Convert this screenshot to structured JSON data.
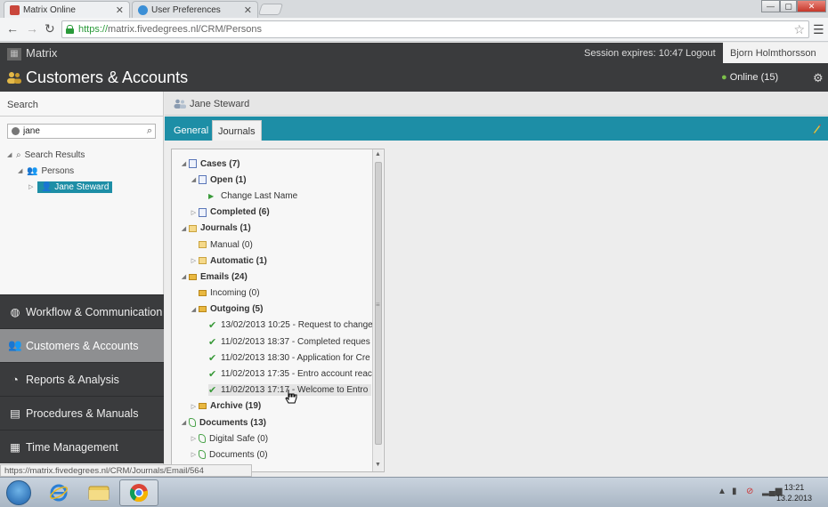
{
  "browser": {
    "tabs": [
      {
        "label": "Matrix Online",
        "active": true
      },
      {
        "label": "User Preferences",
        "active": false
      }
    ],
    "url_scheme": "https://",
    "url_rest": "matrix.fivedegrees.nl/CRM/Persons",
    "status_url": "https://matrix.fivedegrees.nl/CRM/Journals/Email/564"
  },
  "app": {
    "logo": "Matrix",
    "session": "Session expires: 10:47",
    "logout": "Logout",
    "user": "Bjorn Holmthorsson",
    "title": "Customers & Accounts",
    "online": "Online (15)"
  },
  "left": {
    "search_label": "Search",
    "search_value": "jane",
    "tree": {
      "root": "Search Results",
      "group": "Persons",
      "person": "Jane Steward"
    },
    "nav": [
      {
        "label": "Workflow & Communication",
        "active": false
      },
      {
        "label": "Customers & Accounts",
        "active": true
      },
      {
        "label": "Reports & Analysis",
        "active": false
      },
      {
        "label": "Procedures & Manuals",
        "active": false
      },
      {
        "label": "Time Management",
        "active": false
      }
    ]
  },
  "main": {
    "person": "Jane Steward",
    "tabs": [
      {
        "label": "General",
        "active": false
      },
      {
        "label": "Journals",
        "active": true
      }
    ],
    "tree": {
      "cases": "Cases (7)",
      "open": "Open (1)",
      "change_last_name": "Change Last Name",
      "completed": "Completed (6)",
      "journals": "Journals (1)",
      "manual": "Manual (0)",
      "automatic": "Automatic (1)",
      "emails": "Emails (24)",
      "incoming": "Incoming (0)",
      "outgoing": "Outgoing (5)",
      "mails": [
        "13/02/2013 10:25 - Request to change",
        "11/02/2013 18:37 - Completed reques",
        "11/02/2013 18:30 - Application for Cre",
        "11/02/2013 17:35 - Entro account reac",
        "11/02/2013 17:17 - Welcome to Entro"
      ],
      "archive": "Archive (19)",
      "documents": "Documents (13)",
      "digital_safe": "Digital Safe (0)",
      "documents_sub": "Documents (0)"
    }
  },
  "taskbar": {
    "time": "13:21",
    "date": "13.2.2013"
  },
  "colors": {
    "accent": "#1d8ea6",
    "dark": "#3a3b3d"
  }
}
